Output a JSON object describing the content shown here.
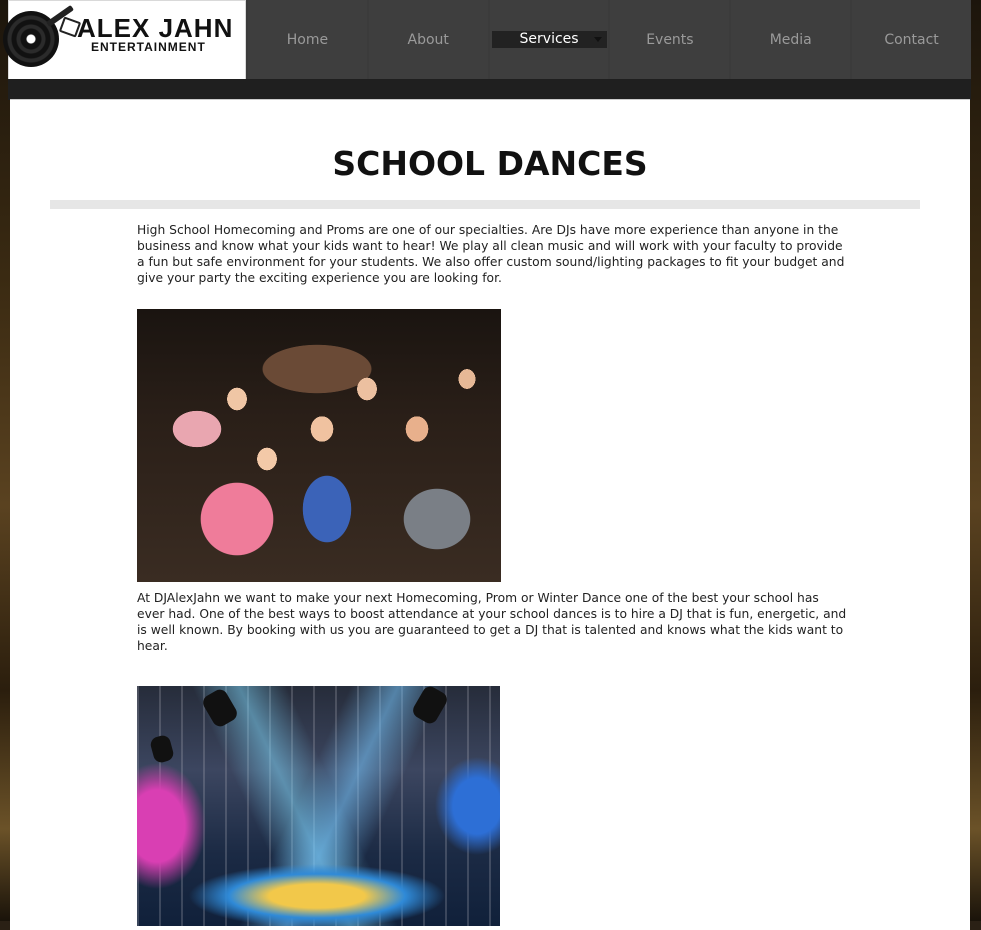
{
  "logo": {
    "title": "ALEX JAHN",
    "subtitle": "ENTERTAINMENT"
  },
  "nav": {
    "items": [
      "Home",
      "About",
      "Services",
      "Events",
      "Media",
      "Contact"
    ],
    "active": "Services"
  },
  "page": {
    "title": "SCHOOL DANCES",
    "paragraph1": "High School Homecoming and Proms are one of our specialties. Are DJs have more experience than anyone in the business and know what your kids want to hear! We play all clean music and will work with your faculty to provide a fun but safe environment for your students. We also offer custom sound/lighting packages to fit your budget and give your party the exciting experience you are looking for.",
    "paragraph2": "At DJAlexJahn we want to make your next Homecoming, Prom or Winter Dance one of the best your school has ever had. One of the best ways to boost attendance at your school dances is to hire a DJ that is fun, energetic, and is well known. By booking with us you are guaranteed to get a DJ that is talented and knows what the kids want to hear."
  },
  "colors": {
    "nav_bg": "#3e3e3e",
    "nav_text": "#9a9a9a",
    "active_bg": "#222222",
    "panel_bg": "#ffffff"
  }
}
